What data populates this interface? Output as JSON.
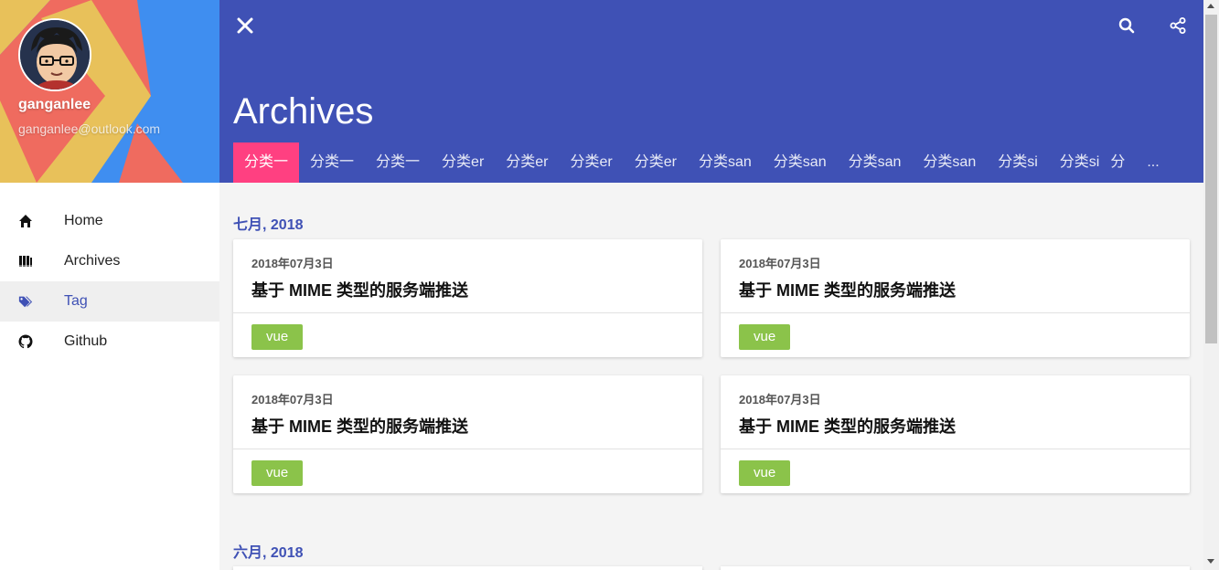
{
  "sidebar": {
    "profile": {
      "name": "ganganlee",
      "email": "ganganlee@outlook.com"
    },
    "items": [
      {
        "label": "Home",
        "icon": "home-icon"
      },
      {
        "label": "Archives",
        "icon": "archives-icon"
      },
      {
        "label": "Tag",
        "icon": "tag-icon",
        "active": true
      },
      {
        "label": "Github",
        "icon": "github-icon"
      }
    ]
  },
  "header": {
    "title": "Archives",
    "tabs": [
      "分类一",
      "分类一",
      "分类一",
      "分类er",
      "分类er",
      "分类er",
      "分类er",
      "分类san",
      "分类san",
      "分类san",
      "分类san",
      "分类si",
      "分类si",
      "分"
    ],
    "more_label": "...",
    "accent_color": "#3f51b5",
    "active_tab_color": "#ff4081"
  },
  "archive": {
    "groups": [
      {
        "month": "七月, 2018",
        "posts": [
          {
            "date": "2018年07月3日",
            "title": "基于 MIME 类型的服务端推送",
            "tag": "vue"
          },
          {
            "date": "2018年07月3日",
            "title": "基于 MIME 类型的服务端推送",
            "tag": "vue"
          },
          {
            "date": "2018年07月3日",
            "title": "基于 MIME 类型的服务端推送",
            "tag": "vue"
          },
          {
            "date": "2018年07月3日",
            "title": "基于 MIME 类型的服务端推送",
            "tag": "vue"
          }
        ]
      },
      {
        "month": "六月, 2018",
        "posts": []
      }
    ],
    "tag_color": "#8bc34a"
  }
}
